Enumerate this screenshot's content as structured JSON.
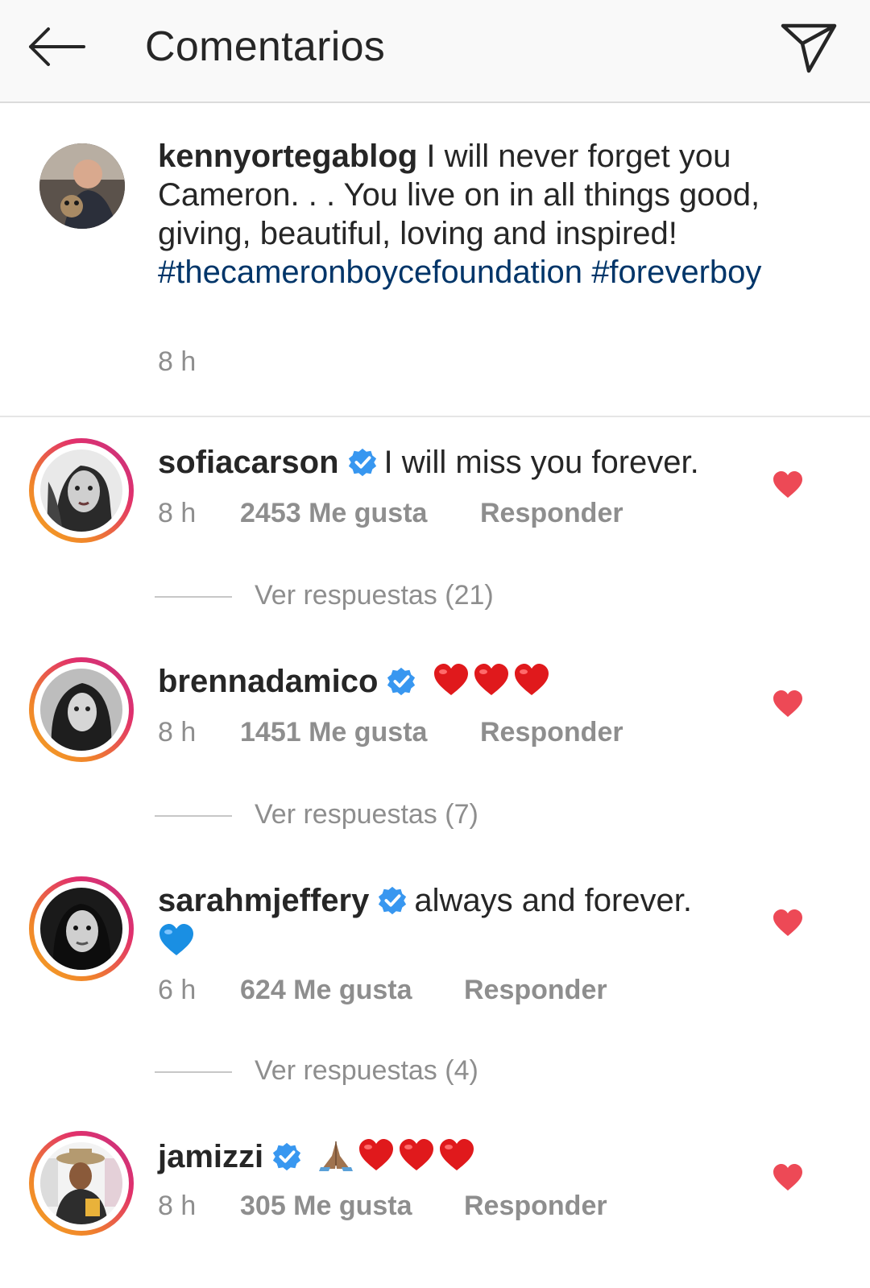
{
  "header": {
    "title": "Comentarios"
  },
  "caption": {
    "username": "kennyortegablog",
    "text": "I will never forget you Cameron. . . You live on in all things good, giving, beautiful, loving and inspired!",
    "hashtag1": "#thecameronboycefoundation",
    "hashtag2": "#foreverboy",
    "time": "8 h"
  },
  "comments": [
    {
      "username": "sofiacarson",
      "text": "I will miss you forever.",
      "time": "8 h",
      "likes": "2453 Me gusta",
      "reply": "Responder",
      "replies": "Ver respuestas (21)"
    },
    {
      "username": "brennadamico",
      "text": "",
      "emoji": "❤️❤️❤️",
      "time": "8 h",
      "likes": "1451 Me gusta",
      "reply": "Responder",
      "replies": "Ver respuestas (7)"
    },
    {
      "username": "sarahmjeffery",
      "text": "always and forever.",
      "emoji": "💙",
      "time": "6 h",
      "likes": "624 Me gusta",
      "reply": "Responder",
      "replies": "Ver respuestas (4)"
    },
    {
      "username": "jamizzi",
      "text": "",
      "emoji": "🙏🏾❤️❤️❤️",
      "time": "8 h",
      "likes": "305 Me gusta",
      "reply": "Responder"
    }
  ],
  "colors": {
    "hashtag": "#003569",
    "verified": "#3897f0",
    "like_heart": "#ed4956",
    "muted": "#8e8e8e"
  }
}
